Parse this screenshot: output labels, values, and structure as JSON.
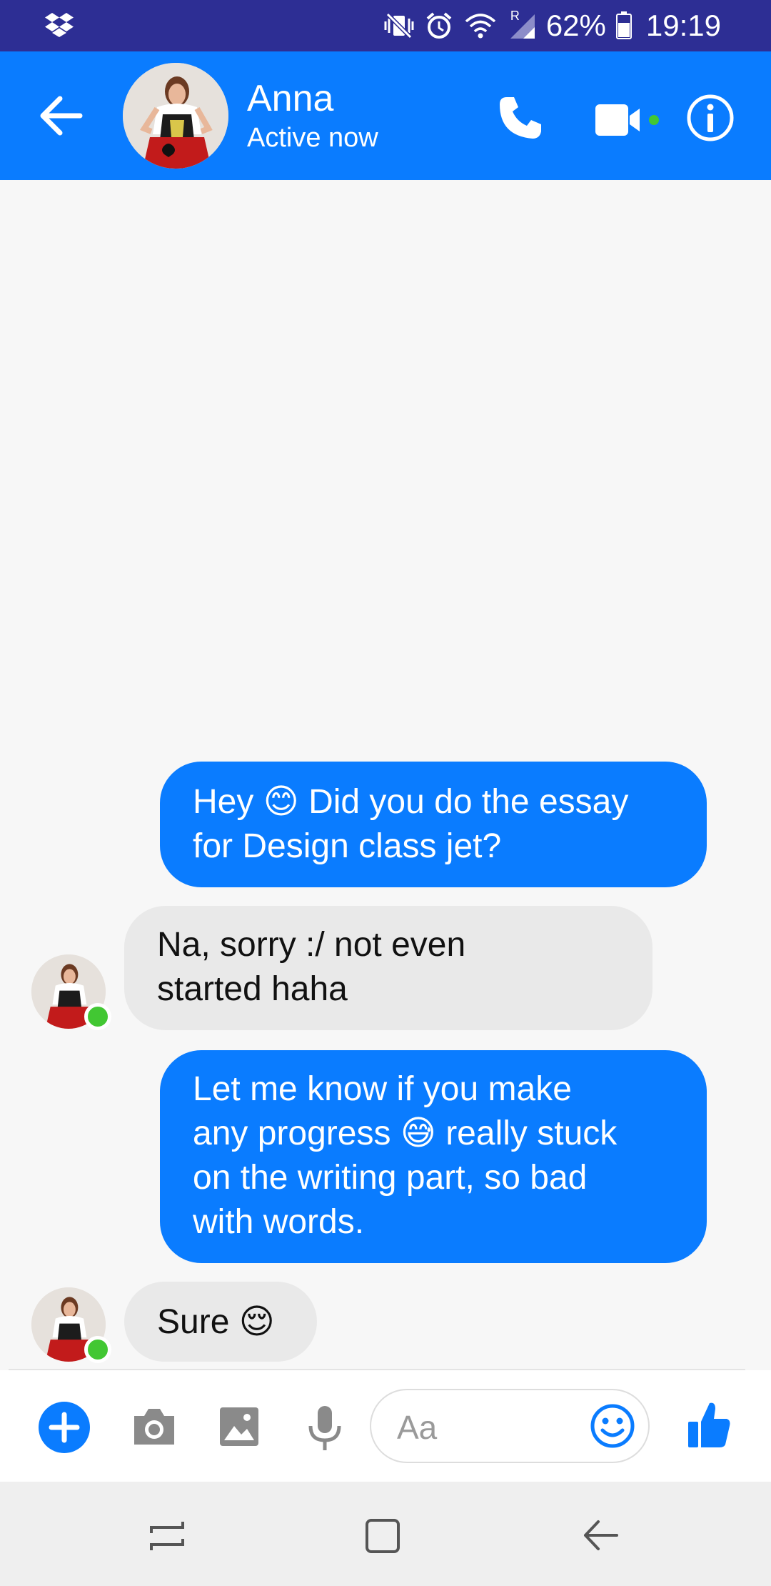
{
  "status_bar": {
    "battery_percent": "62%",
    "time": "19:19",
    "network_label": "R",
    "icons": [
      "dropbox-icon",
      "vibrate-icon",
      "alarm-icon",
      "wifi-icon",
      "signal-icon",
      "battery-icon"
    ]
  },
  "header": {
    "contact_name": "Anna",
    "contact_status": "Active now",
    "accent_color": "#0a7cff",
    "icons": [
      "back-arrow-icon",
      "phone-icon",
      "video-camera-icon",
      "info-icon"
    ]
  },
  "messages": [
    {
      "direction": "outgoing",
      "lines": [
        "Hey 😊 Did you do the essay",
        "for Design class jet?"
      ]
    },
    {
      "direction": "incoming",
      "lines": [
        "Na, sorry :/ not even",
        "started haha"
      ]
    },
    {
      "direction": "outgoing",
      "lines": [
        "Let me know if you make",
        "any progress 😅 really stuck",
        "on the writing part, so bad",
        "with words."
      ]
    },
    {
      "direction": "incoming",
      "lines": [
        "Sure 😌"
      ]
    }
  ],
  "composer": {
    "placeholder": "Aa",
    "icons": [
      "plus-icon",
      "camera-icon",
      "gallery-icon",
      "microphone-icon",
      "emoji-icon",
      "thumbs-up-icon"
    ]
  },
  "navigation_bar": {
    "icons": [
      "recents-icon",
      "home-icon",
      "back-icon"
    ]
  }
}
